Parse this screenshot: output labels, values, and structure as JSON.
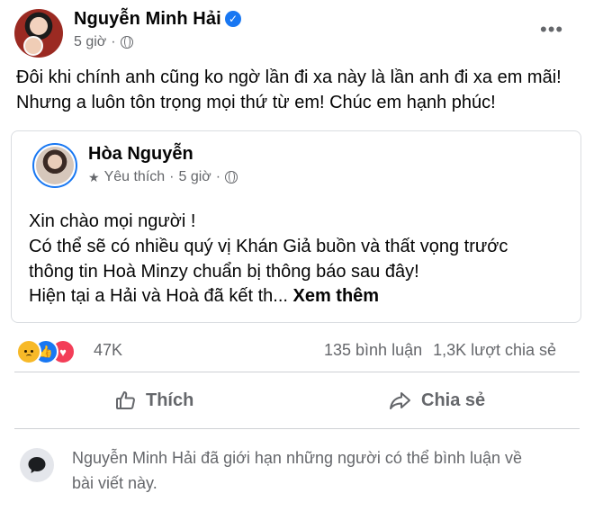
{
  "post": {
    "author": "Nguyễn Minh Hải",
    "time": "5 giờ",
    "text_lines": [
      "Đôi khi chính anh cũng ko ngờ lần đi xa này là lần anh đi xa em mãi!",
      "Nhưng a luôn tôn trọng mọi thứ từ em! Chúc em hạnh phúc!"
    ]
  },
  "shared": {
    "author": "Hòa Nguyễn",
    "favorite_label": "Yêu thích",
    "time": "5 giờ",
    "text_lines": [
      "Xin chào mọi người !",
      "Có thể sẽ có nhiều quý vị Khán Giả buồn và thất vọng trước",
      "thông tin Hoà Minzy chuẩn bị thông báo sau đây!"
    ],
    "last_line": "Hiện tại a Hải và Hoà đã kết th...",
    "see_more": "Xem thêm"
  },
  "engagement": {
    "reaction_count": "47K",
    "comments": "135 bình luận",
    "shares": "1,3K lượt chia sẻ"
  },
  "actions": {
    "like_label": "Thích",
    "share_label": "Chia sẻ"
  },
  "notice": {
    "lines": [
      "Nguyễn Minh Hải đã giới hạn những người có thể bình luận về",
      "bài viết này."
    ]
  },
  "colors": {
    "brand_blue": "#1877f2",
    "secondary_text": "#65676b",
    "love_red": "#f33e58",
    "sad_yellow": "#f7b928"
  }
}
